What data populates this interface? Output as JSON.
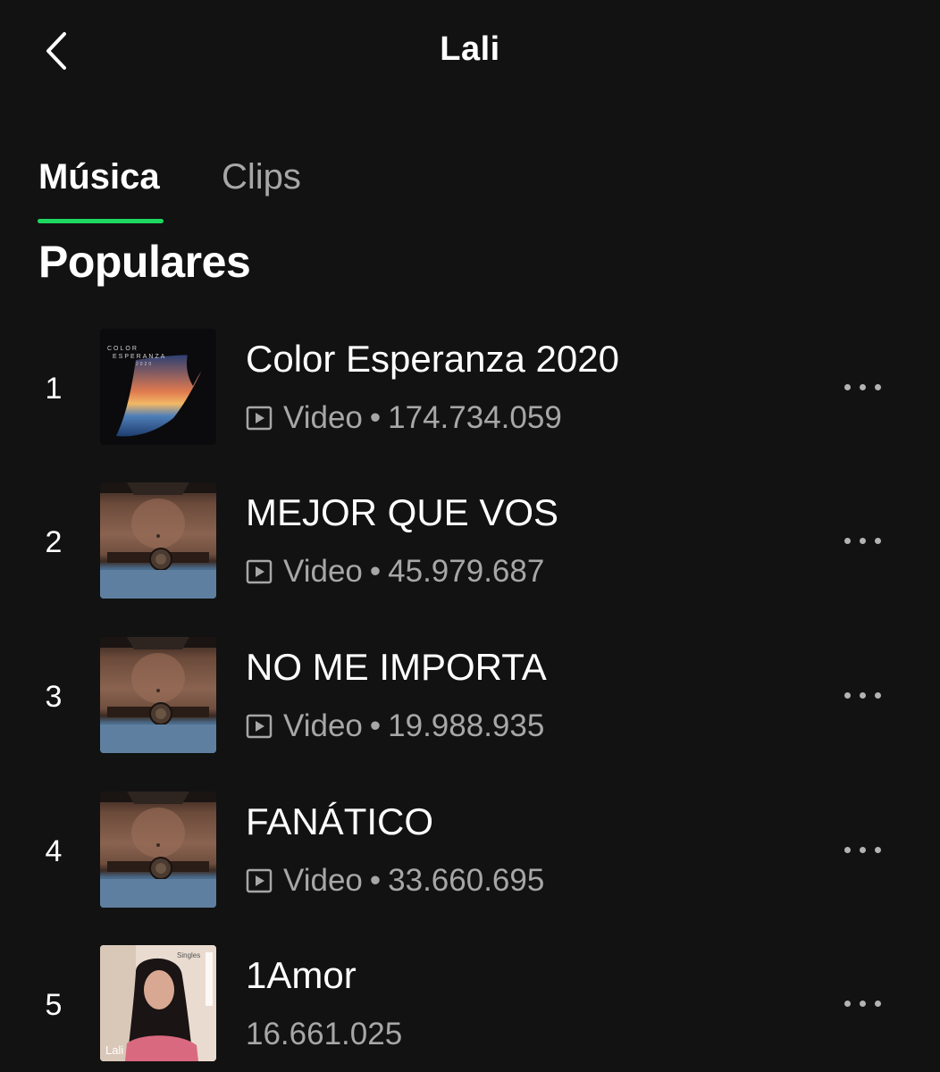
{
  "header": {
    "title": "Lali"
  },
  "tabs": [
    {
      "label": "Música",
      "active": true
    },
    {
      "label": "Clips",
      "active": false
    }
  ],
  "colors": {
    "background": "#121212",
    "accent": "#1ed760",
    "secondary_text": "#a7a7a7"
  },
  "section": {
    "title": "Populares"
  },
  "tracks": [
    {
      "rank": "1",
      "title": "Color Esperanza 2020",
      "badge": "Video",
      "separator": "•",
      "plays": "174.734.059",
      "cover": "color-esperanza-2020-cover"
    },
    {
      "rank": "2",
      "title": "MEJOR QUE VOS",
      "badge": "Video",
      "separator": "•",
      "plays": "45.979.687",
      "cover": "torso-belt-cover"
    },
    {
      "rank": "3",
      "title": "NO ME IMPORTA",
      "badge": "Video",
      "separator": "•",
      "plays": "19.988.935",
      "cover": "torso-belt-cover"
    },
    {
      "rank": "4",
      "title": "FANÁTICO",
      "badge": "Video",
      "separator": "•",
      "plays": "33.660.695",
      "cover": "torso-belt-cover"
    },
    {
      "rank": "5",
      "title": "1Amor",
      "badge": "",
      "separator": "",
      "plays": "16.661.025",
      "cover": "1amor-singles-cover"
    }
  ],
  "covers": {
    "esperanza_text_top": "COLOR",
    "esperanza_text_mid": "ESPERANZA",
    "esperanza_text_year": "2020",
    "amor_singles": "Singles",
    "amor_artist": "Lali"
  }
}
